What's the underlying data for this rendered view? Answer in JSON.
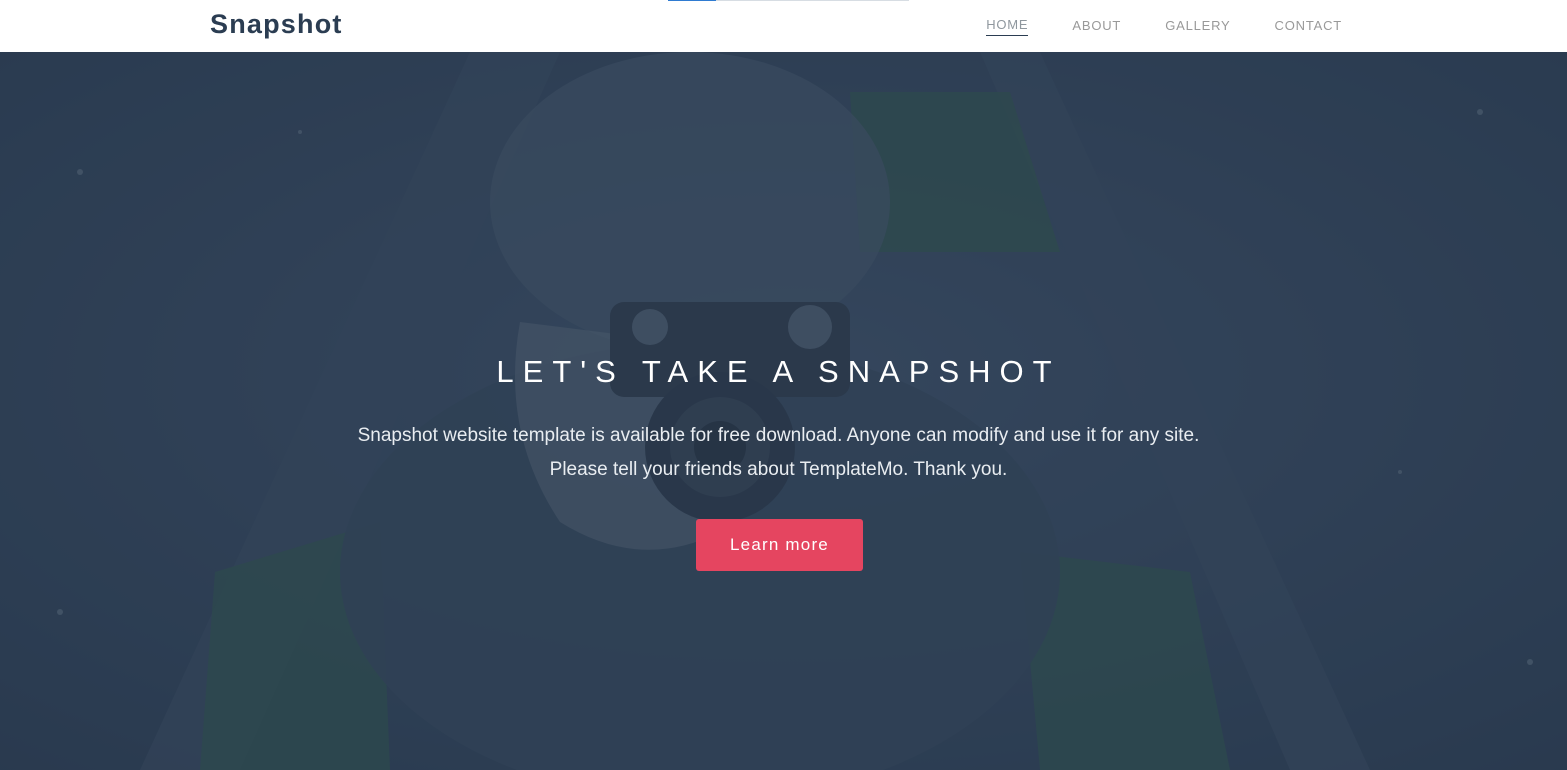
{
  "brand": "Snapshot",
  "nav": {
    "items": [
      {
        "label": "HOME",
        "active": true
      },
      {
        "label": "ABOUT",
        "active": false
      },
      {
        "label": "GALLERY",
        "active": false
      },
      {
        "label": "CONTACT",
        "active": false
      }
    ]
  },
  "hero": {
    "title": "LET'S TAKE A SNAPSHOT",
    "text_line1": "Snapshot website template is available for free download. Anyone can modify and use it for any site.",
    "text_line2": "Please tell your friends about TemplateMo. Thank you.",
    "button_label": "Learn more",
    "background_image": "photographer-with-camera-photo"
  },
  "colors": {
    "navbar_bg": "#ffffff",
    "brand": "#2b3d52",
    "nav_link": "#999999",
    "hero_overlay": "#2b3c52",
    "button_bg": "#e54560",
    "button_text": "#ffffff",
    "progress_fill": "#2f7bd1"
  },
  "progress": {
    "fraction": 0.2
  }
}
